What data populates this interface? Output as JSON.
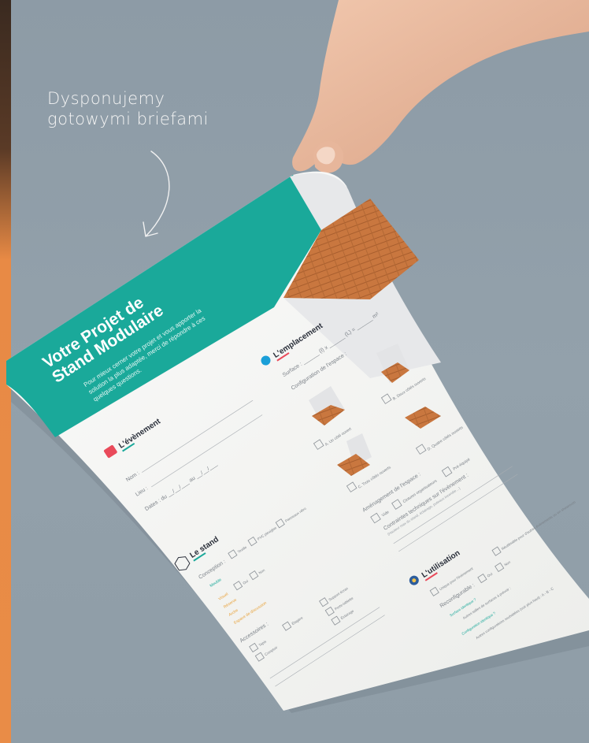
{
  "annotation": {
    "line1": "Dysponujemy",
    "line2": "gotowymi briefami"
  },
  "brief": {
    "title_line1": "Votre Projet de",
    "title_line2": "Stand Modulaire",
    "intro_line1": "Pour mieux cerner votre projet et vous apporter la",
    "intro_line2": "solution la plus adaptée, merci de répondre à ces",
    "intro_line3": "quelques questions.",
    "evenement": {
      "heading": "L'évènement",
      "nom": "Nom :",
      "lieu": "Lieu :",
      "dates": "Dates : du __/__/___ au __/__/___"
    },
    "stand": {
      "heading": "Le stand",
      "conception": "Conception :",
      "opt_textile": "Textile",
      "opt_pvc": "PVC plexiglas",
      "opt_panneau": "Panneaux rétro",
      "meuble": "Meuble",
      "visuel": "Visuel",
      "reserve": "Réserve",
      "arche": "Arche",
      "espace": "Espace de discussion",
      "oui": "Oui",
      "non": "Non",
      "accessoires": "Accessoires :",
      "acc_tapis": "Tapis",
      "acc_comptoir": "Comptoir",
      "acc_etagere": "Étagère",
      "acc_support": "Support écran",
      "acc_porte": "Porte-tablette",
      "acc_eclairage": "Éclairage"
    },
    "emplacement": {
      "heading": "L'emplacement",
      "surface": "Surface : ______ (l) x ______ (L) = ______ m²",
      "config": "Configuration de l'espace :",
      "opt_a": "A. Un côté ouvert",
      "opt_b": "B. Deux côtés ouverts",
      "opt_c": "C. Trois côtés ouverts",
      "opt_d": "D. Quatre côtés ouverts",
      "amenagement": "Aménagement de l'espace :",
      "vide": "Vide",
      "orga": "Clotures organisateurs",
      "preequipe": "Pré-équipé",
      "contraintes": "Contraintes techniques sur l'évènement :",
      "contraintes_sub": "(Hauteur max du stand, éclairage, poteaux incendie…)"
    },
    "utilisation": {
      "heading": "L'utilisation",
      "unique": "Unique pour l'évènement",
      "reutilisable": "Réutilisable pour d'autres évènements ou en showroom",
      "reconfig": "Reconfigurable :",
      "oui": "Oui",
      "non": "Non",
      "surface_id": "Surface identique ?",
      "autres_tailles": "Autres tailles de surfaces à prévoir :",
      "config_id": "Configuration identique ?",
      "autres_config": "Autres configurations souhaitées (voir plus haut) : A - B - C"
    }
  },
  "colors": {
    "teal": "#1aa99a",
    "accent": "#e94a5a",
    "paper": "#f7f7f5",
    "background": "#909ea8"
  }
}
